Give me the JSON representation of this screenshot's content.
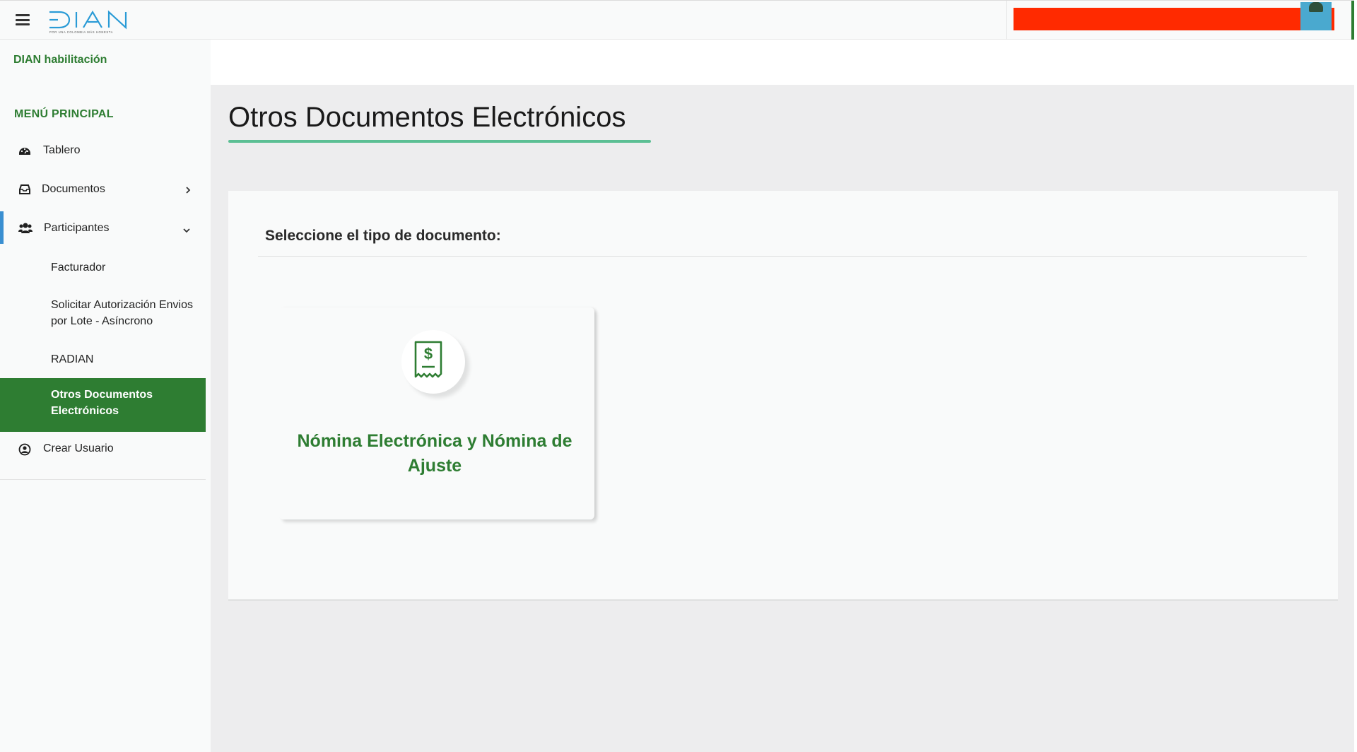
{
  "header": {
    "menu_icon": "hamburger-icon",
    "logo_text": "DIAN",
    "logo_tagline": "POR UNA COLOMBIA MÁS HONESTA",
    "colors": {
      "brand_blue": "#2a9bd6",
      "redaction": "#ff2a00"
    }
  },
  "sidebar": {
    "app_name": "DIAN habilitación",
    "menu_title": "MENÚ PRINCIPAL",
    "items": [
      {
        "label": "Tablero",
        "icon": "dashboard-icon"
      },
      {
        "label": "Documentos",
        "icon": "inbox-icon",
        "chevron": "chevron-right-icon"
      },
      {
        "label": "Participantes",
        "icon": "users-icon",
        "chevron": "chevron-down-icon",
        "expanded": true
      }
    ],
    "sub_items": [
      {
        "label": "Facturador"
      },
      {
        "label": "Solicitar Autorización Envios por Lote - Asíncrono"
      },
      {
        "label": "RADIAN"
      },
      {
        "label": "Otros Documentos Electrónicos",
        "active": true
      }
    ],
    "bottom_item": {
      "label": "Crear Usuario",
      "icon": "user-circle-icon"
    },
    "colors": {
      "accent_green": "#2e7d32",
      "active_indicator": "#3a8fd1"
    }
  },
  "main": {
    "title": "Otros Documentos Electrónicos",
    "panel_heading": "Seleccione el tipo de documento:",
    "cards": [
      {
        "label": "Nómina Electrónica y Nómina de Ajuste",
        "icon": "receipt-dollar-icon"
      }
    ],
    "colors": {
      "title_underline": "#5cbf94",
      "card_text": "#2e7d32"
    }
  }
}
